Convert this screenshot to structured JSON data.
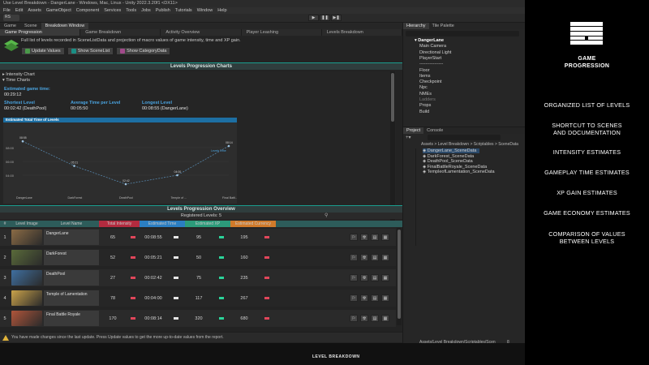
{
  "window": {
    "title": "Use Level Breakdown - DangerLane - Windows, Mac, Linux - Unity 2022.3.20f1 <DX11>"
  },
  "menu": [
    "File",
    "Edit",
    "Assets",
    "GameObject",
    "Component",
    "Services",
    "Tools",
    "Jobs",
    "Publish",
    "Tutorials",
    "Window",
    "Help"
  ],
  "toolbar": {
    "account": "RS",
    "play": "▶",
    "pause": "❚❚",
    "step": "▶❚"
  },
  "dock_tabs": [
    "Game",
    "Scene",
    "Breakdown Window"
  ],
  "sub_tabs": [
    "Game Progression",
    "Game Breakdown",
    "Activity Overview",
    "Player Leashing",
    "Levels Breakdown"
  ],
  "description": "Full list of levels recorded in SceneListData and projection of macro values of game intensity, time and XP gain.",
  "actions": [
    {
      "label": "Update Values",
      "color": "#4a9a4a"
    },
    {
      "label": "Show SceneList",
      "color": "#1a8f85"
    },
    {
      "label": "Show CategoryData",
      "color": "#a14a8a"
    }
  ],
  "charts_section": {
    "header": "Levels Progression Charts",
    "intensity_label": "Intensity Chart",
    "time_label": "Time Charts",
    "estimated_label": "Estimated game time:",
    "estimated_value": "00:29:12",
    "shortest_label": "Shortest Level",
    "shortest_value": "00:02:42 (DeathPool)",
    "average_label": "Average Time per Level",
    "average_value": "00:05:50",
    "longest_label": "Longest Level",
    "longest_value": "00:08:55 (DangerLane)",
    "graph_title": "Estimated Total Time of Levels",
    "accum_title": "Accumulated Time of Levels",
    "legend": "Levels Time",
    "yticks": [
      "08:00",
      "06:00",
      "04:00"
    ]
  },
  "chart_data": {
    "type": "line",
    "title": "Estimated Total Time of Levels",
    "categories": [
      "DangerLane",
      "DarkForest",
      "DeathPool",
      "Temple of ...",
      "Final Battl..."
    ],
    "series": [
      {
        "name": "Levels Time",
        "values": [
          "08:55",
          "05:21",
          "02:42",
          "04:00",
          "08:14"
        ]
      }
    ],
    "values_seconds": [
      535,
      321,
      162,
      240,
      494
    ],
    "ylim_seconds": [
      120,
      600
    ]
  },
  "overview": {
    "header": "Levels Progression Overview",
    "registered": "Registered Levels: 5",
    "columns": [
      {
        "label": "#",
        "color": "#2d5c5a"
      },
      {
        "label": "Level Image",
        "color": "#2d5c5a"
      },
      {
        "label": "Level Name",
        "color": "#2d5c5a"
      },
      {
        "label": "Total Intensity",
        "color": "#b32b3f"
      },
      {
        "label": "Estimated Time",
        "color": "#2b7ec2"
      },
      {
        "label": "Estimated XP",
        "color": "#2c9b7a"
      },
      {
        "label": "Estimated Currency",
        "color": "#d07a2a"
      }
    ],
    "rows": [
      {
        "num": "1",
        "name": "DangerLane",
        "intensity": "65",
        "time": "00:08:55",
        "xp": "95",
        "currency": "195",
        "img": "#8b6b45"
      },
      {
        "num": "2",
        "name": "DarkForest",
        "intensity": "52",
        "time": "00:05:21",
        "xp": "50",
        "currency": "160",
        "img": "#5a6b3a"
      },
      {
        "num": "3",
        "name": "DeathPool",
        "intensity": "27",
        "time": "00:02:42",
        "xp": "75",
        "currency": "235",
        "img": "#3f6fa0"
      },
      {
        "num": "4",
        "name": "Temple of Lamentation",
        "intensity": "78",
        "time": "00:04:00",
        "xp": "117",
        "currency": "267",
        "img": "#c9a24a"
      },
      {
        "num": "5",
        "name": "Final Battle Royale",
        "intensity": "170",
        "time": "00:08:14",
        "xp": "320",
        "currency": "680",
        "img": "#b0553a"
      }
    ]
  },
  "warning": "You have made changes since the last update. Press Update values to get the more up-to-date values from the report.",
  "hierarchy": {
    "tabs": [
      "Hierarchy",
      "Tile Palette"
    ],
    "items": [
      "DangerLane",
      "Main Camera",
      "Directional Light",
      "PlayerStart",
      "----------------",
      "Floor",
      "Items",
      "Checkpoint",
      "Npc",
      "NMEs",
      "Ladders",
      "Props",
      "Build"
    ]
  },
  "project": {
    "tabs": [
      "Project",
      "Console"
    ],
    "breadcrumb": "Assets > Level Breakdown > Scriptables > SceneData",
    "files": [
      "DangerLane_SceneData",
      "DarkForest_SceneData",
      "DeathPool_SceneData",
      "FinalBattleRoyale_SceneData",
      "TempleofLamentation_SceneData"
    ],
    "status": "Assets/Level Breakdown/Scriptables/Scen",
    "count": "8"
  },
  "brand": "LEVEL BREAKDOWN",
  "promo": {
    "title_line1": "GAME",
    "title_line2": "PROGRESSION",
    "features": [
      [
        "ORGANIZED LIST OF LEVELS"
      ],
      [
        "SHORTCUT TO SCENES",
        "AND DOCUMENTATION"
      ],
      [
        "INTENSITY ESTIMATES"
      ],
      [
        "GAMEPLAY TIME ESTIMATES"
      ],
      [
        "XP GAIN ESTIMATES"
      ],
      [
        "GAME ECONOMY ESTIMATES"
      ],
      [
        "COMPARISON OF VALUES",
        "BETWEEN LEVELS"
      ]
    ]
  }
}
